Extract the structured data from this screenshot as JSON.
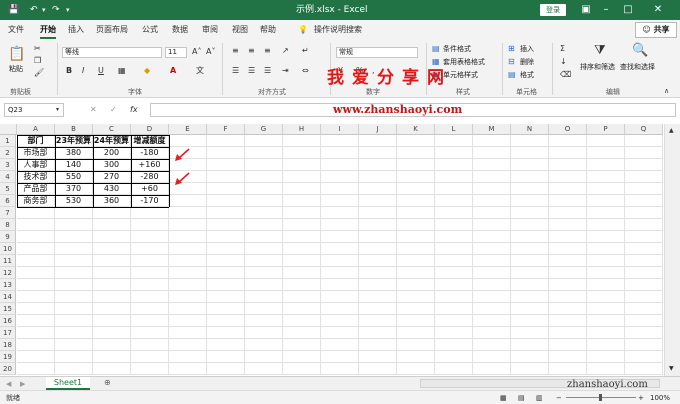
{
  "titlebar": {
    "file_title": "示例.xlsx - Excel",
    "login_label": "登录",
    "colors": {
      "accent": "#217346"
    }
  },
  "tabs": [
    {
      "label": "文件",
      "active": false
    },
    {
      "label": "开始",
      "active": true
    },
    {
      "label": "插入",
      "active": false
    },
    {
      "label": "页面布局",
      "active": false
    },
    {
      "label": "公式",
      "active": false
    },
    {
      "label": "数据",
      "active": false
    },
    {
      "label": "审阅",
      "active": false
    },
    {
      "label": "视图",
      "active": false
    },
    {
      "label": "帮助",
      "active": false
    }
  ],
  "search_hint": "操作说明搜索",
  "share_label": "共享",
  "ribbon": {
    "clipboard": {
      "paste_label": "粘贴",
      "group_label": "剪贴板"
    },
    "font": {
      "font_name": "等线",
      "font_size": "11",
      "group_label": "字体",
      "bold": "B",
      "italic": "I",
      "underline": "U"
    },
    "alignment": {
      "group_label": "对齐方式"
    },
    "number": {
      "format": "常规",
      "group_label": "数字"
    },
    "styles": {
      "cond_format": "条件格式",
      "table_format": "套用表格格式",
      "cell_style": "单元格样式",
      "group_label": "样式"
    },
    "cells": {
      "insert": "插入",
      "delete": "删除",
      "format": "格式",
      "group_label": "单元格"
    },
    "editing": {
      "sort_filter": "排序和筛选",
      "find_select": "查找和选择",
      "group_label": "编辑"
    }
  },
  "namebox": "Q23",
  "formula_fx": "fx",
  "columns": [
    "A",
    "B",
    "C",
    "D",
    "E",
    "F",
    "G",
    "H",
    "I",
    "J",
    "K",
    "L",
    "M",
    "N",
    "O",
    "P",
    "Q"
  ],
  "rows": [
    "1",
    "2",
    "3",
    "4",
    "5",
    "6",
    "7",
    "8",
    "9",
    "10",
    "11",
    "12",
    "13",
    "14",
    "15",
    "16",
    "17",
    "18",
    "19",
    "20"
  ],
  "table": {
    "headers": [
      "部门",
      "23年预算",
      "24年预算",
      "增减额度"
    ],
    "rows": [
      [
        "市场部",
        "380",
        "200",
        "-180"
      ],
      [
        "人事部",
        "140",
        "300",
        "+160"
      ],
      [
        "技术部",
        "550",
        "270",
        "-280"
      ],
      [
        "产品部",
        "370",
        "430",
        "+60"
      ],
      [
        "商务部",
        "530",
        "360",
        "-170"
      ]
    ]
  },
  "sheet_tab": "Sheet1",
  "status": {
    "ready": "就绪",
    "zoom": "100%"
  },
  "watermark": {
    "cn": "我爱分享网",
    "url": "www.zhanshaoyi.com",
    "corner": "zhanshaoyi.com"
  }
}
